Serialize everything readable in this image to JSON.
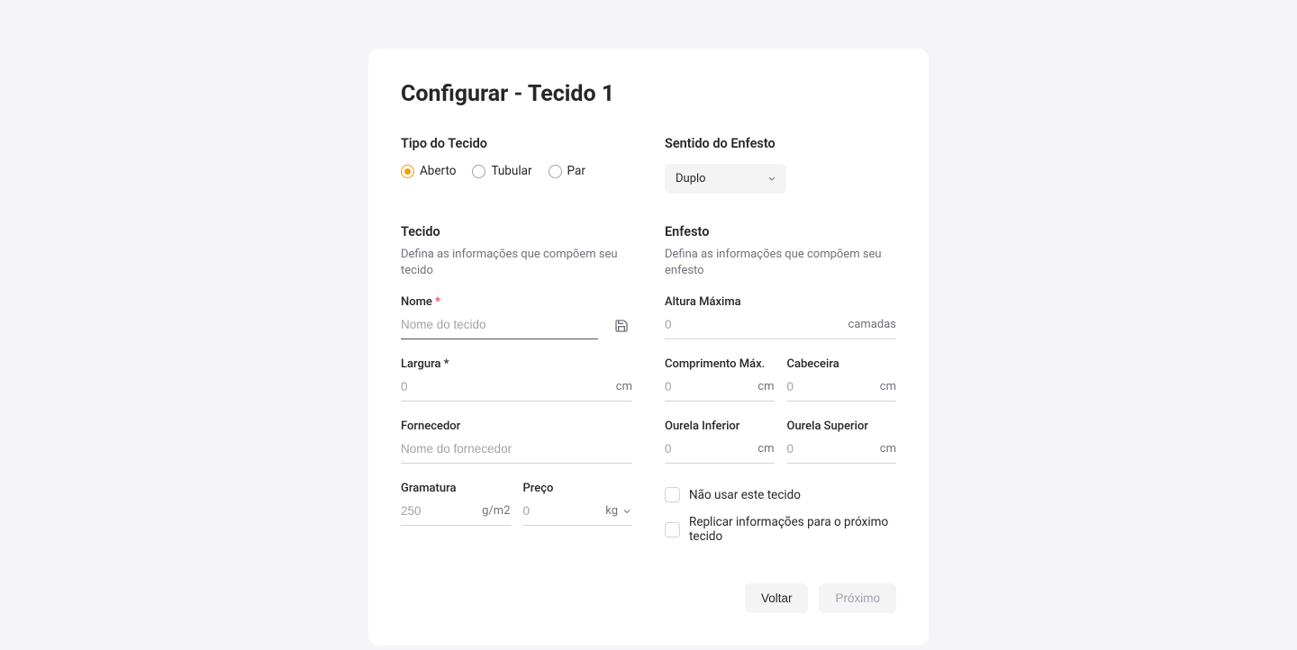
{
  "page_title": "Configurar - Tecido 1",
  "left_top": {
    "heading": "Tipo do Tecido",
    "options": {
      "aberto": "Aberto",
      "tubular": "Tubular",
      "par": "Par"
    }
  },
  "right_top": {
    "heading": "Sentido do Enfesto",
    "selected": "Duplo"
  },
  "tecido": {
    "heading": "Tecido",
    "desc": "Defina as informações que compõem seu tecido",
    "nome": {
      "label": "Nome",
      "placeholder": "Nome do tecido",
      "value": ""
    },
    "largura": {
      "label": "Largura *",
      "placeholder": "0",
      "value": "",
      "unit": "cm"
    },
    "fornecedor": {
      "label": "Fornecedor",
      "placeholder": "Nome do fornecedor",
      "value": ""
    },
    "gramatura": {
      "label": "Gramatura",
      "placeholder": "250",
      "value": "",
      "unit": "g/m2"
    },
    "preco": {
      "label": "Preço",
      "placeholder": "0",
      "value": "",
      "unit": "kg"
    }
  },
  "enfesto": {
    "heading": "Enfesto",
    "desc": "Defina as informações que compõem seu enfesto",
    "altura_maxima": {
      "label": "Altura Máxima",
      "placeholder": "0",
      "value": "",
      "unit": "camadas"
    },
    "comprimento_max": {
      "label": "Comprimento Máx.",
      "placeholder": "0",
      "value": "",
      "unit": "cm"
    },
    "cabeceira": {
      "label": "Cabeceira",
      "placeholder": "0",
      "value": "",
      "unit": "cm"
    },
    "ourela_inferior": {
      "label": "Ourela Inferior",
      "placeholder": "0",
      "value": "",
      "unit": "cm"
    },
    "ourela_superior": {
      "label": "Ourela Superior",
      "placeholder": "0",
      "value": "",
      "unit": "cm"
    },
    "nao_usar": "Não usar este tecido",
    "replicar": "Replicar informações para o próximo tecido"
  },
  "footer": {
    "back": "Voltar",
    "next": "Próximo"
  }
}
